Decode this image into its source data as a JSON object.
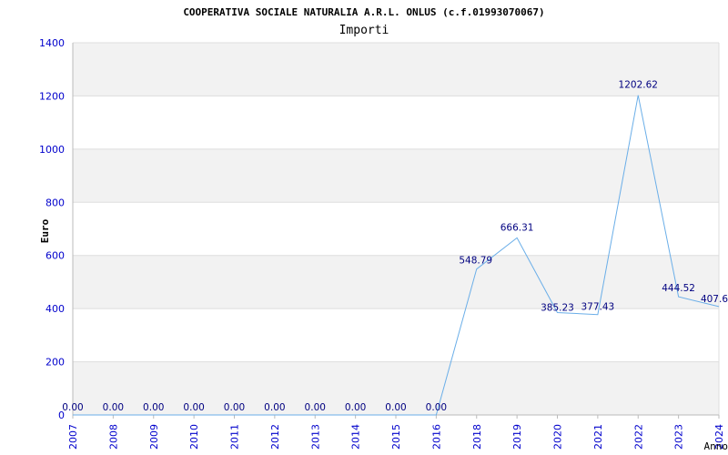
{
  "chart_data": {
    "type": "line",
    "title": "COOPERATIVA SOCIALE NATURALIA A.R.L. ONLUS (c.f.01993070067)",
    "subtitle": "Importi",
    "xlabel": "Anno",
    "ylabel": "Euro",
    "ylim": [
      0,
      1400
    ],
    "yticks": [
      0,
      200,
      400,
      600,
      800,
      1000,
      1200,
      1400
    ],
    "grid": true,
    "categories": [
      "2007",
      "2008",
      "2009",
      "2010",
      "2011",
      "2012",
      "2013",
      "2014",
      "2015",
      "2016",
      "2018",
      "2019",
      "2020",
      "2021",
      "2022",
      "2023",
      "2024"
    ],
    "series": [
      {
        "values": [
          0,
          0,
          0,
          0,
          0,
          0,
          0,
          0,
          0,
          0,
          548.79,
          666.31,
          385.23,
          377.43,
          1202.62,
          444.52,
          407.6
        ],
        "labels": [
          "0.00",
          "0.00",
          "0.00",
          "0.00",
          "0.00",
          "0.00",
          "0.00",
          "0.00",
          "0.00",
          "0.00",
          "548.79",
          "666.31",
          "385.23",
          "377.43",
          "1202.62",
          "444.52",
          "407.6"
        ]
      }
    ],
    "colors": {
      "line": "#6aaee8",
      "band": "#f2f2f2",
      "gridline": "#dddddd",
      "tick_text": "#0000cc",
      "data_label": "#000080"
    }
  }
}
